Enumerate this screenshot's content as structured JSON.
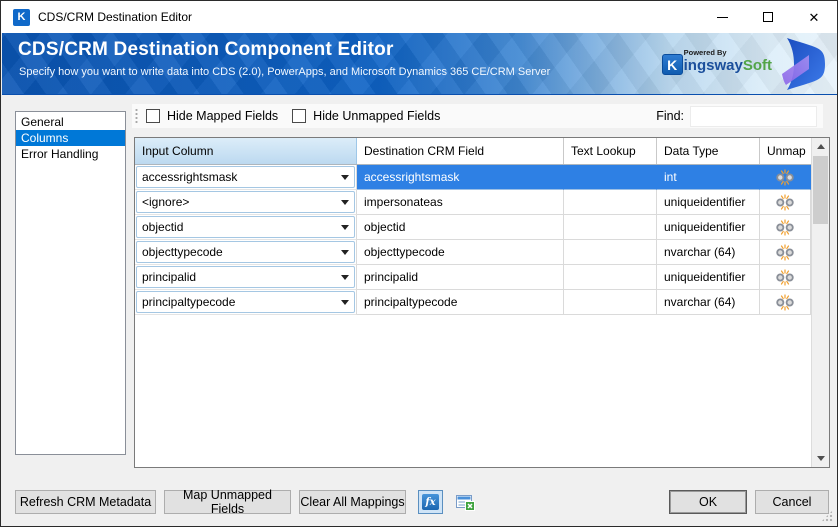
{
  "window": {
    "title": "CDS/CRM Destination Editor",
    "app_icon_letter": "K"
  },
  "header": {
    "title": "CDS/CRM Destination Component Editor",
    "subtitle": "Specify how you want to write data into CDS (2.0), PowerApps, and Microsoft Dynamics 365 CE/CRM Server",
    "logo": {
      "powered_by": "Powered By",
      "k_letter": "K",
      "name_part1": "ingsway",
      "name_part2": "Soft"
    }
  },
  "sidebar": {
    "items": [
      {
        "label": "General",
        "selected": false
      },
      {
        "label": "Columns",
        "selected": true
      },
      {
        "label": "Error Handling",
        "selected": false
      }
    ]
  },
  "toolbar": {
    "hide_mapped_label": "Hide Mapped Fields",
    "hide_mapped_checked": false,
    "hide_unmapped_label": "Hide Unmapped Fields",
    "hide_unmapped_checked": false,
    "find_label": "Find:",
    "find_value": ""
  },
  "table": {
    "columns": [
      "Input Column",
      "Destination CRM Field",
      "Text Lookup",
      "Data Type",
      "Unmap"
    ],
    "rows": [
      {
        "input": "accessrightsmask",
        "destination": "accessrightsmask",
        "text_lookup": "",
        "data_type": "int",
        "selected": true
      },
      {
        "input": "<ignore>",
        "destination": "impersonateas",
        "text_lookup": "",
        "data_type": "uniqueidentifier",
        "selected": false
      },
      {
        "input": "objectid",
        "destination": "objectid",
        "text_lookup": "",
        "data_type": "uniqueidentifier",
        "selected": false
      },
      {
        "input": "objecttypecode",
        "destination": "objecttypecode",
        "text_lookup": "",
        "data_type": "nvarchar (64)",
        "selected": false
      },
      {
        "input": "principalid",
        "destination": "principalid",
        "text_lookup": "",
        "data_type": "uniqueidentifier",
        "selected": false
      },
      {
        "input": "principaltypecode",
        "destination": "principaltypecode",
        "text_lookup": "",
        "data_type": "nvarchar (64)",
        "selected": false
      }
    ]
  },
  "footer": {
    "buttons": [
      "Refresh CRM Metadata",
      "Map Unmapped Fields",
      "Clear All Mappings"
    ],
    "fx_label": "fx",
    "ok_label": "OK",
    "cancel_label": "Cancel"
  },
  "colors": {
    "banner_blue": "#0E63C6",
    "selection_blue": "#2E80E4",
    "sidebar_selection": "#0078D7",
    "header_cell_blue": "#C9E2F5",
    "kingsway_blue": "#1B4F9C",
    "kingsway_green": "#52A447",
    "unmap_spark_orange": "#F0A030"
  }
}
